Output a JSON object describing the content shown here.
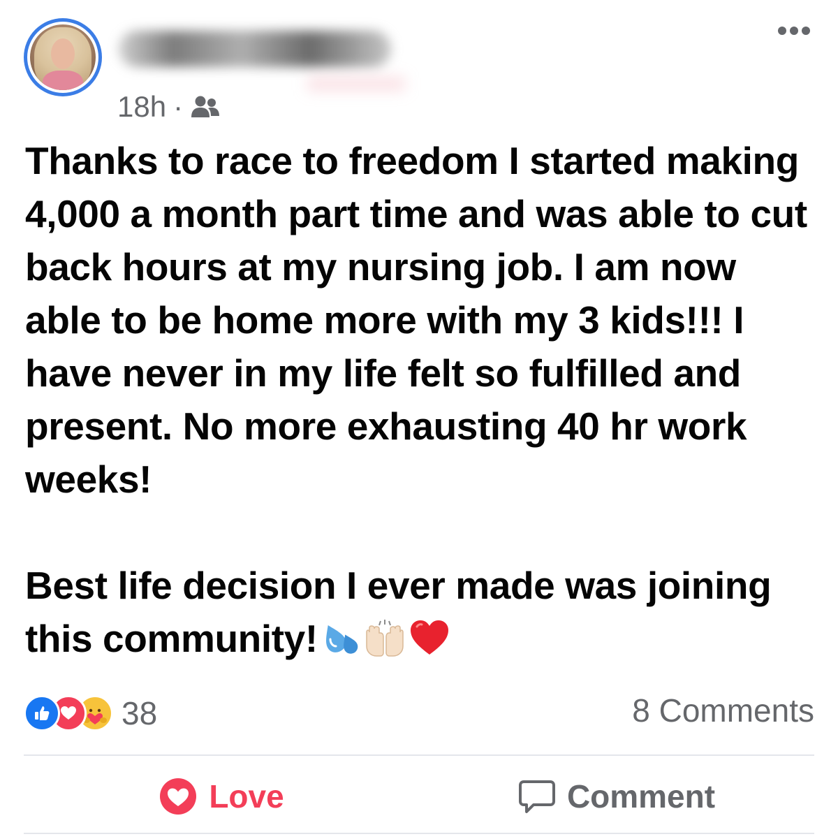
{
  "post": {
    "author_avatar": "avatar-photo",
    "timestamp": "18h",
    "separator": "·",
    "audience_icon": "friends-icon",
    "more_icon": "more-options-icon",
    "paragraphs": [
      "Thanks to race to freedom I started making 4,000 a month part time and was able to cut back hours at my nursing job. I am now able to be home more with my 3 kids!!! I have never in my life felt so fulfilled and present. No more exhausting 40 hr work weeks!",
      "Best life decision I ever made was joining this community!"
    ],
    "emojis": [
      "sweat-droplets-icon",
      "raising-hands-icon",
      "red-heart-icon"
    ]
  },
  "reactions": {
    "icons": [
      "like-icon",
      "love-icon",
      "care-icon"
    ],
    "count": "38",
    "comments_label": "8 Comments"
  },
  "actions": {
    "love_label": "Love",
    "comment_label": "Comment"
  },
  "colors": {
    "accent_blue": "#1877f2",
    "love_red": "#f33e58",
    "secondary_text": "#65676b",
    "divider": "#e4e6eb"
  }
}
